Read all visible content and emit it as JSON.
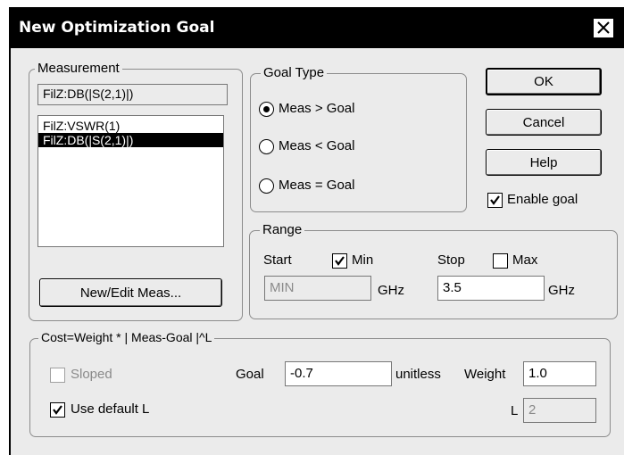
{
  "window": {
    "title": "New Optimization Goal",
    "close_icon": "close-icon"
  },
  "measurement": {
    "legend": "Measurement",
    "selected_value": "FilZ:DB(|S(2,1)|)",
    "list_items": [
      {
        "label": "FilZ:VSWR(1)",
        "selected": false
      },
      {
        "label": "FilZ:DB(|S(2,1)|)",
        "selected": true
      }
    ],
    "new_edit_button": "New/Edit Meas..."
  },
  "goal_type": {
    "legend": "Goal Type",
    "options": [
      {
        "label": "Meas > Goal",
        "checked": true
      },
      {
        "label": "Meas < Goal",
        "checked": false
      },
      {
        "label": "Meas = Goal",
        "checked": false
      }
    ]
  },
  "buttons": {
    "ok": "OK",
    "cancel": "Cancel",
    "help": "Help"
  },
  "enable_goal": {
    "label": "Enable goal",
    "checked": true
  },
  "range": {
    "legend": "Range",
    "start_label": "Start",
    "min_label": "Min",
    "min_checked": true,
    "stop_label": "Stop",
    "max_label": "Max",
    "max_checked": false,
    "start_value": "MIN",
    "start_unit": "GHz",
    "stop_value": "3.5",
    "stop_unit": "GHz"
  },
  "cost": {
    "legend": "Cost=Weight * | Meas-Goal |^L",
    "sloped_label": "Sloped",
    "sloped_checked": false,
    "goal_label": "Goal",
    "goal_value": "-0.7",
    "goal_unit": "unitless",
    "weight_label": "Weight",
    "weight_value": "1.0",
    "use_default_l_label": "Use default L",
    "use_default_l_checked": true,
    "l_label": "L",
    "l_value": "2"
  }
}
